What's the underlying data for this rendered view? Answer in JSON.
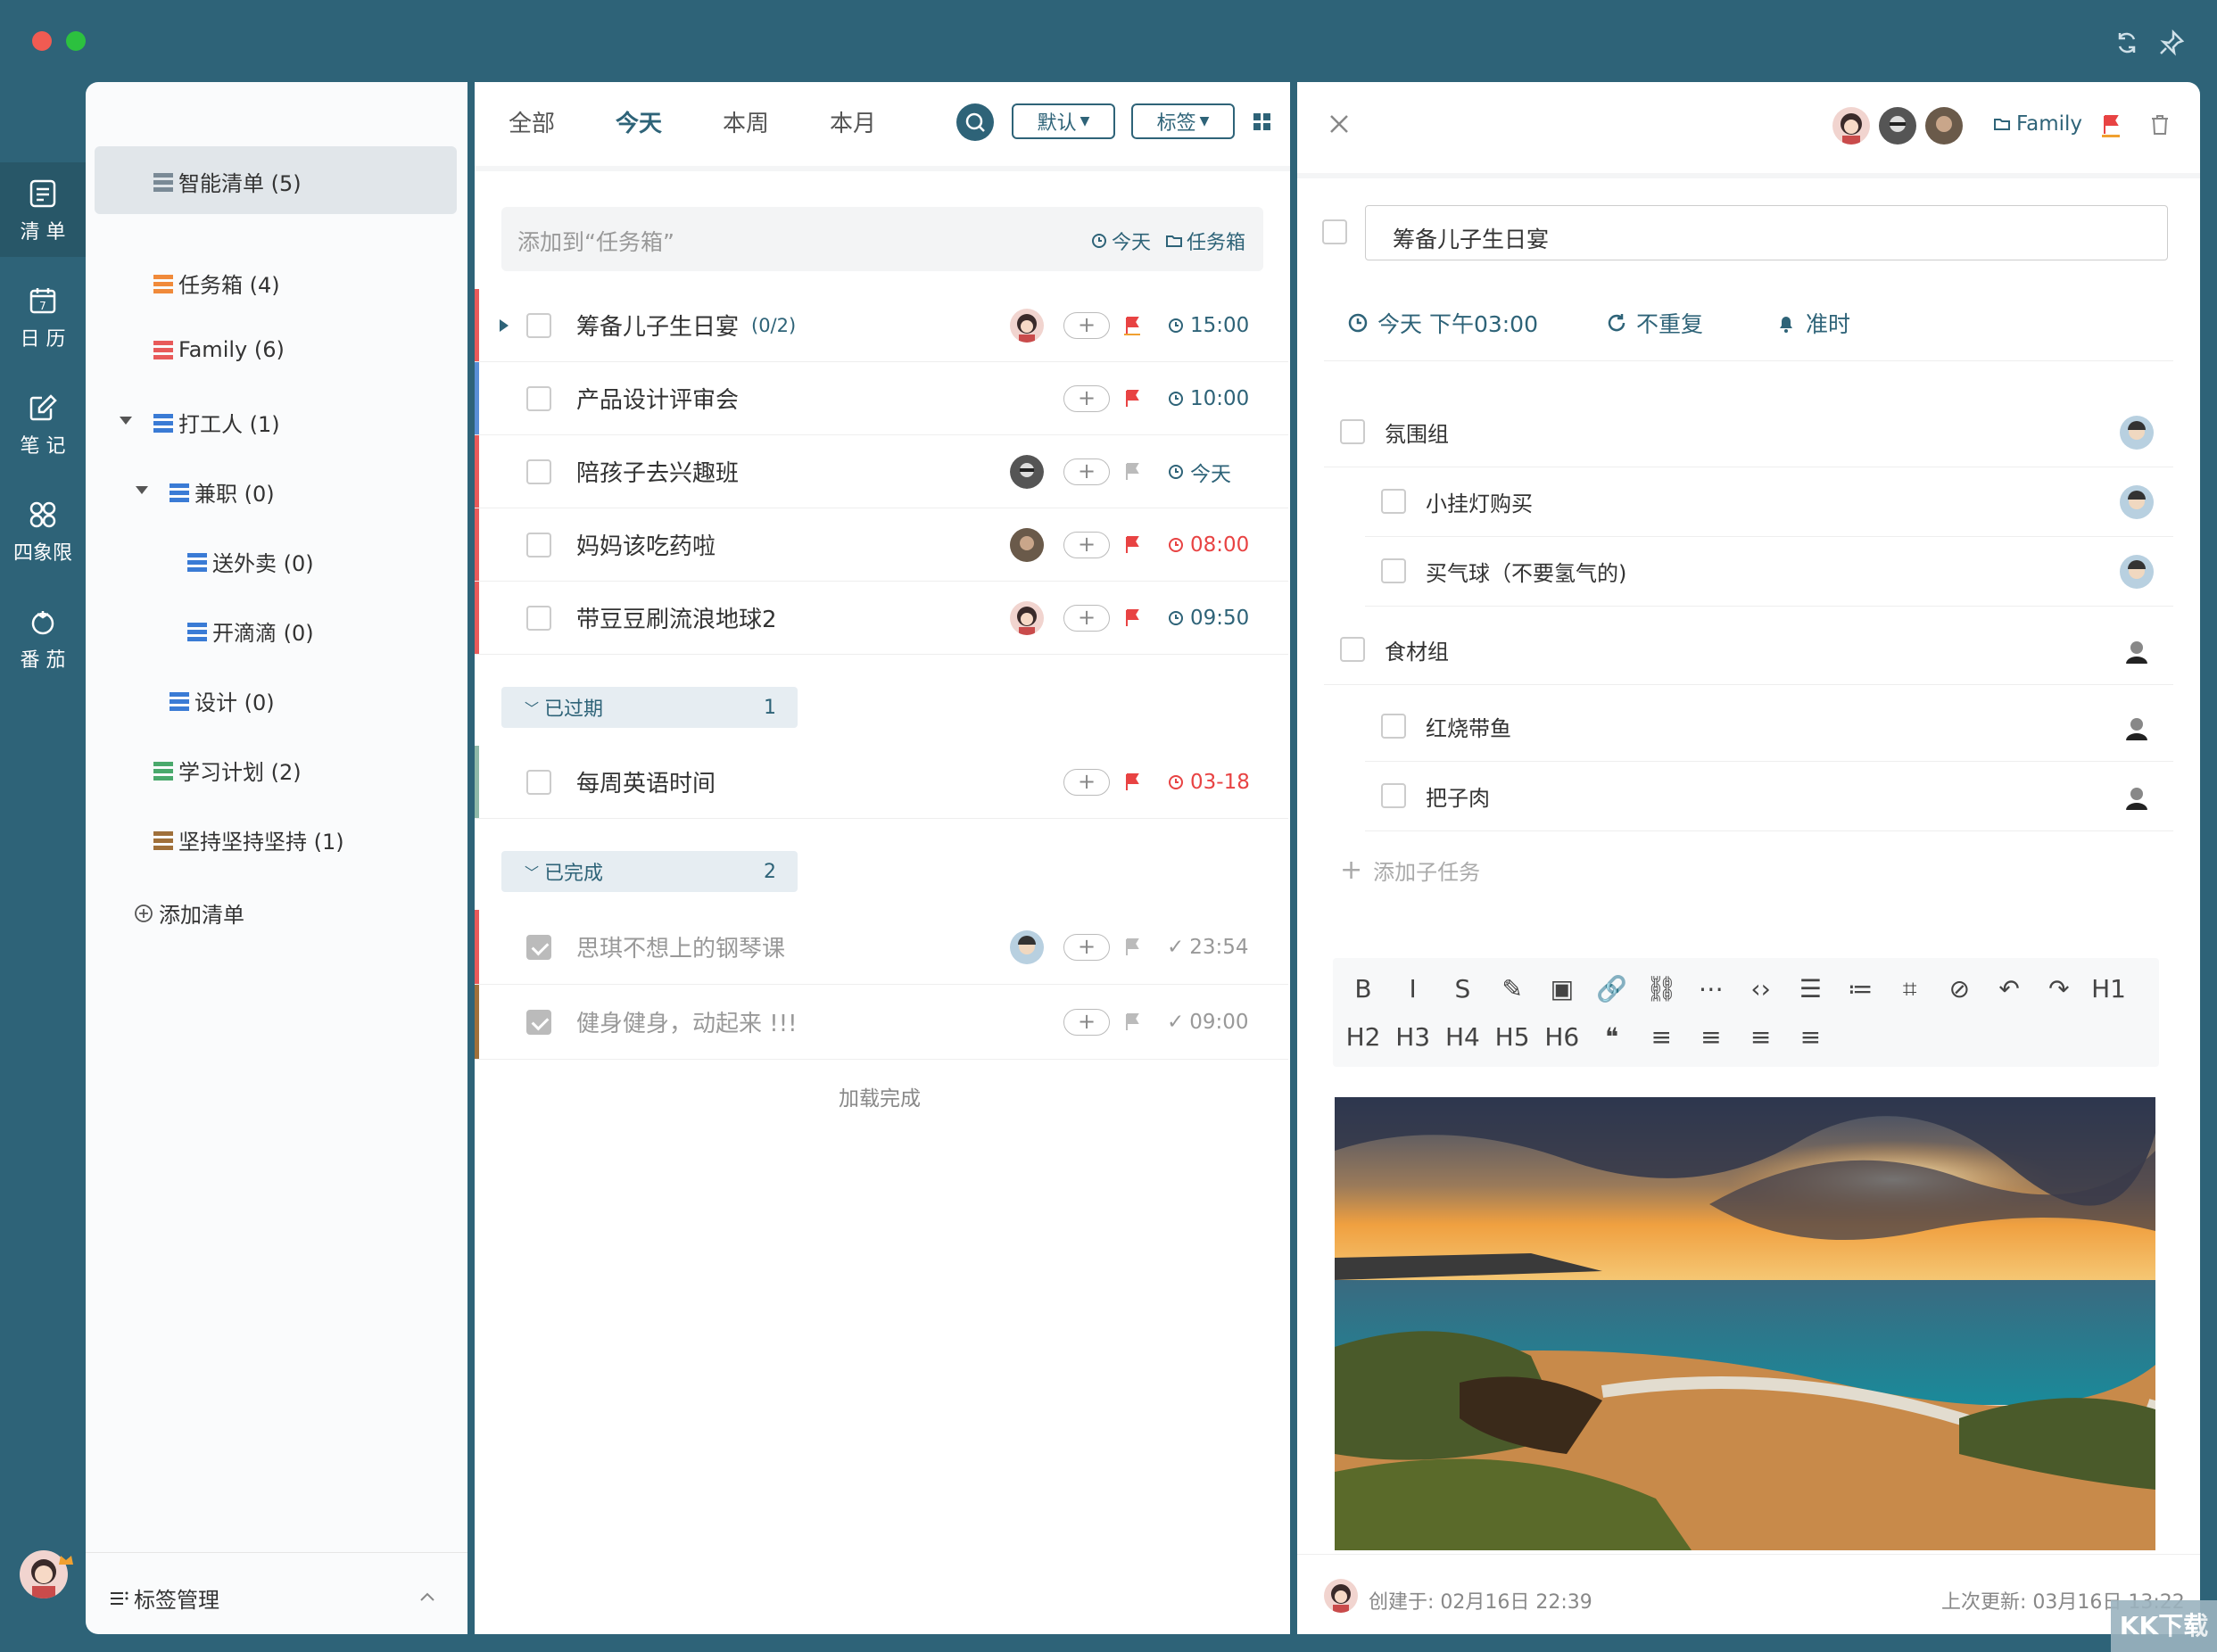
{
  "rail": {
    "items": [
      {
        "label": "清 单",
        "icon": "list-icon"
      },
      {
        "label": "日 历",
        "icon": "calendar-icon"
      },
      {
        "label": "笔 记",
        "icon": "note-icon"
      },
      {
        "label": "四象限",
        "icon": "quadrant-icon"
      },
      {
        "label": "番 茄",
        "icon": "tomato-icon"
      }
    ]
  },
  "lists": {
    "smart": "智能清单 (5)",
    "inbox": "任务箱 (4)",
    "family": "Family (6)",
    "worker": "打工人 (1)",
    "parttime": "兼职 (0)",
    "delivery": "送外卖 (0)",
    "didi": "开滴滴 (0)",
    "design": "设计 (0)",
    "study": "学习计划 (2)",
    "persist": "坚持坚持坚持 (1)",
    "add": "添加清单",
    "tag_manage": "标签管理"
  },
  "tabs": {
    "all": "全部",
    "today": "今天",
    "week": "本周",
    "month": "本月",
    "sort": "默认",
    "tag": "标签"
  },
  "add_task": {
    "placeholder": "添加到“任务箱”",
    "date": "今天",
    "list": "任务箱"
  },
  "tasks": [
    {
      "title": "筹备儿子生日宴",
      "sub": "(0/2)",
      "time": "15:00"
    },
    {
      "title": "产品设计评审会",
      "time": "10:00"
    },
    {
      "title": "陪孩子去兴趣班",
      "time": "今天"
    },
    {
      "title": "妈妈该吃药啦",
      "time": "08:00"
    },
    {
      "title": "带豆豆刷流浪地球2",
      "time": "09:50"
    }
  ],
  "overdue": {
    "label": "已过期",
    "count": "1",
    "task": "每周英语时间",
    "time": "03-18"
  },
  "completed": {
    "label": "已完成",
    "count": "2",
    "tasks": [
      {
        "title": "思琪不想上的钢琴课",
        "time": "23:54"
      },
      {
        "title": "健身健身，动起来 !!!",
        "time": "09:00"
      }
    ]
  },
  "load_done": "加载完成",
  "detail": {
    "list": "Family",
    "title": "筹备儿子生日宴",
    "due": "今天 下午03:00",
    "repeat": "不重复",
    "remind": "准时",
    "subtasks": [
      {
        "title": "氛围组",
        "level": 0
      },
      {
        "title": "小挂灯购买",
        "level": 1
      },
      {
        "title": "买气球（不要氢气的)",
        "level": 1
      },
      {
        "title": "食材组",
        "level": 0
      },
      {
        "title": "红烧带鱼",
        "level": 1
      },
      {
        "title": "把子肉",
        "level": 1
      }
    ],
    "add_sub": "添加子任务",
    "toolbar1": [
      "B",
      "I",
      "S",
      "✎",
      "▣",
      "🔗",
      "⛓",
      "⋯",
      "‹›",
      "☰",
      "≔",
      "⌗",
      "⊘",
      "↶",
      "↷",
      "H1"
    ],
    "toolbar2": [
      "H2",
      "H3",
      "H4",
      "H5",
      "H6",
      "❝",
      "≡",
      "≡",
      "≡",
      "≡"
    ],
    "created": "创建于: 02月16日 22:39",
    "updated": "上次更新: 03月16日 13:22"
  },
  "watermark": "KK下载",
  "colors": {
    "accent": "#2e6378",
    "red": "#e84343",
    "orange": "#e8703a"
  }
}
